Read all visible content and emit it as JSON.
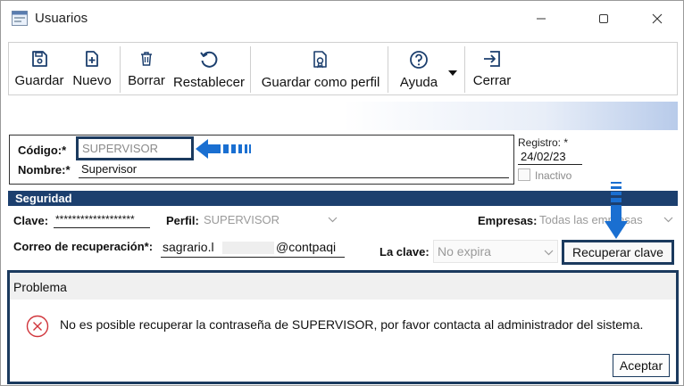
{
  "window": {
    "title": "Usuarios"
  },
  "toolbar": {
    "guardar": "Guardar",
    "nuevo": "Nuevo",
    "borrar": "Borrar",
    "restablecer": "Restablecer",
    "guardar_perfil": "Guardar como perfil",
    "ayuda": "Ayuda",
    "cerrar": "Cerrar"
  },
  "identity": {
    "codigo_label": "Código:*",
    "codigo_value": "SUPERVISOR",
    "nombre_label": "Nombre:*",
    "nombre_value": "Supervisor",
    "registro_label": "Registro: *",
    "registro_value": "24/02/23",
    "inactivo_label": "Inactivo"
  },
  "seguridad": {
    "header": "Seguridad",
    "clave_label": "Clave:",
    "clave_value": "*******************",
    "perfil_label": "Perfil:",
    "perfil_value": "SUPERVISOR",
    "empresas_label": "Empresas:",
    "empresas_value": "Todas las empresas",
    "correo_label": "Correo de recuperación*:",
    "correo_user": "sagrario.l",
    "correo_domain": "@contpaqi",
    "la_clave_label": "La clave:",
    "la_clave_value": "No expira",
    "recuperar_button": "Recuperar clave"
  },
  "problem": {
    "title": "Problema",
    "message": "No es posible recuperar la contraseña de SUPERVISOR, por favor contacta al administrador del sistema.",
    "ok_button": "Aceptar"
  },
  "colors": {
    "accent": "#1b3a5e",
    "arrow": "#1a6fd1",
    "error": "#d0343a"
  }
}
